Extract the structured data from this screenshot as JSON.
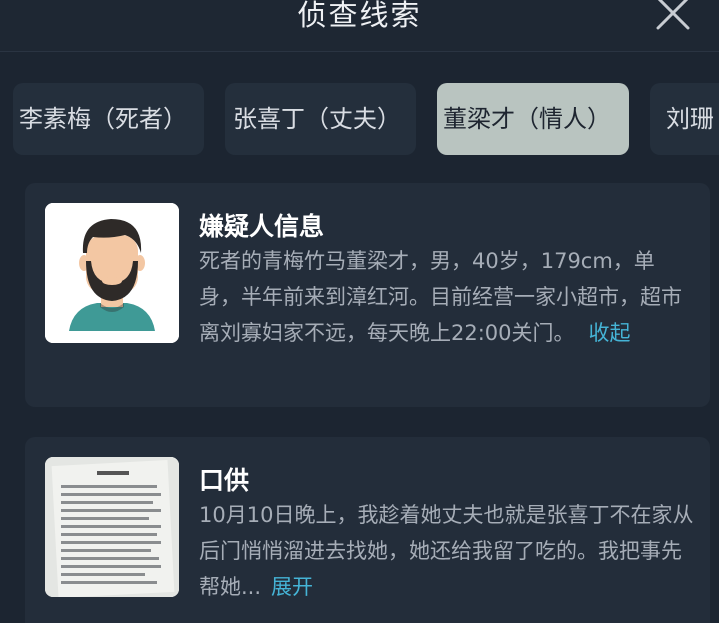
{
  "header": {
    "title": "侦查线索",
    "close_icon": "close-icon"
  },
  "tabs": [
    {
      "label": "李素梅（死者）",
      "active": false
    },
    {
      "label": "张喜丁（丈夫）",
      "active": false
    },
    {
      "label": "董梁才（情人）",
      "active": true
    },
    {
      "label": "刘珊",
      "active": false
    }
  ],
  "cards": [
    {
      "title": "嫌疑人信息",
      "body": "死者的青梅竹马董梁才，男，40岁，179cm，单身，半年前来到漳红河。目前经营一家小超市，超市离刘寡妇家不远，每天晚上22:00关门。",
      "toggle": "收起",
      "thumbnail": "avatar-portrait"
    },
    {
      "title": "口供",
      "body": "10月10日晚上，我趁着她丈夫也就是张喜丁不在家从后门悄悄溜进去找她，她还给我留了吃的。我把事先帮她...",
      "toggle": "展开",
      "thumbnail": "document-photo"
    }
  ],
  "colors": {
    "background": "#1c2531",
    "card": "#232d3a",
    "tab_active": "#b9c4c0",
    "link": "#45b4d6"
  }
}
